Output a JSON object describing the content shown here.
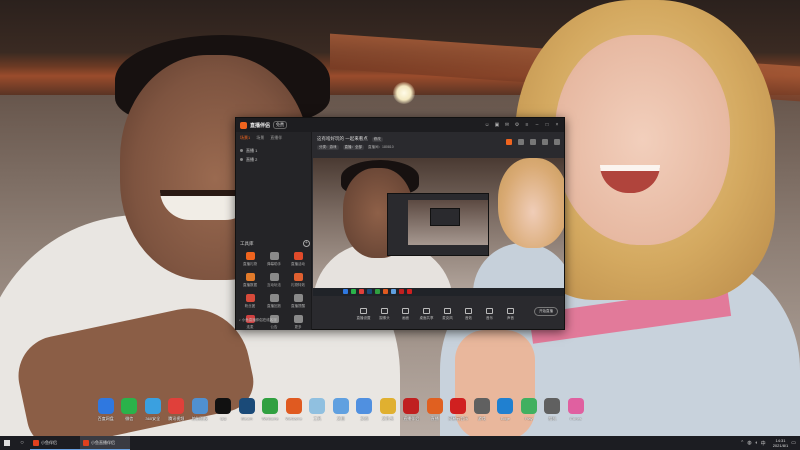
{
  "app": {
    "title": "直播伴侣",
    "version_badge": "免费",
    "scene_tabs": [
      "场景1",
      "场景",
      "直播伴"
    ],
    "scenes": [
      "直播 1",
      "直播 2"
    ],
    "room_title": "这有啥好玩的 一起来看点",
    "room_edit": "修改",
    "tags": [
      "分类：游戏",
      "直播：全部"
    ],
    "room_meta": "直播间：180810",
    "tools_title": "工具库",
    "tools": [
      {
        "label": "直播礼物",
        "icon": "gift-icon",
        "color": "#f0641e"
      },
      {
        "label": "弹幕助手",
        "icon": "danmu-icon",
        "color": "#8a8a8a"
      },
      {
        "label": "直播活动",
        "icon": "activity-icon",
        "color": "#e04a2a"
      },
      {
        "label": "直播数据",
        "icon": "data-icon",
        "color": "#e27a2a"
      },
      {
        "label": "互动玩法",
        "icon": "play-icon",
        "color": "#8a8a8a"
      },
      {
        "label": "礼物特效",
        "icon": "effect-icon",
        "color": "#e06030"
      },
      {
        "label": "粉丝团",
        "icon": "fans-icon",
        "color": "#d84a3a"
      },
      {
        "label": "直播回放",
        "icon": "replay-icon",
        "color": "#8a8a8a"
      },
      {
        "label": "直播提醒",
        "icon": "remind-icon",
        "color": "#8a8a8a"
      },
      {
        "label": "连麦",
        "icon": "link-icon",
        "color": "#d04040"
      },
      {
        "label": "公告",
        "icon": "notice-icon",
        "color": "#8a8a8a"
      },
      {
        "label": "更多",
        "icon": "more-icon",
        "color": "#8a8a8a"
      }
    ],
    "sidebar_footer": "♪ 小鱼直播伴侣在线客服",
    "controls": [
      "直播设置",
      "摄像头",
      "画面",
      "桌面共享",
      "麦克风",
      "音效",
      "音乐",
      "声音"
    ],
    "start_live": "开始直播",
    "accent": "#f0641e"
  },
  "desktop_icons": [
    {
      "label": "百度网盘",
      "color": "#2f78e0"
    },
    {
      "label": "微信",
      "color": "#2ab34a"
    },
    {
      "label": "360安全",
      "color": "#3aa0e0"
    },
    {
      "label": "腾讯视频",
      "color": "#e0403a"
    },
    {
      "label": "控制面板",
      "color": "#5090d0"
    },
    {
      "label": "QQ",
      "color": "#111111"
    },
    {
      "label": "Steam",
      "color": "#1a4a78"
    },
    {
      "label": "WeGame",
      "color": "#30a040"
    },
    {
      "label": "WeGame",
      "color": "#e05a20"
    },
    {
      "label": "工具",
      "color": "#90c0e0"
    },
    {
      "label": "文档",
      "color": "#60a0e0"
    },
    {
      "label": "文档",
      "color": "#5090e0"
    },
    {
      "label": "文件夹",
      "color": "#e0b030"
    },
    {
      "label": "直播伴侣",
      "color": "#c02020"
    },
    {
      "label": "直播",
      "color": "#e06020"
    },
    {
      "label": "网易云音乐",
      "color": "#d02020"
    },
    {
      "label": "游戏",
      "color": "#606060"
    },
    {
      "label": "Edge",
      "color": "#2080d0"
    },
    {
      "label": "Play",
      "color": "#40b060"
    },
    {
      "label": "相机",
      "color": "#606060"
    },
    {
      "label": "iTunes",
      "color": "#e060a0"
    }
  ],
  "taskbar": {
    "items": [
      "小鱼伴侣",
      "小鱼直播伴侣"
    ],
    "time": "14:31",
    "date": "2021/8/1"
  }
}
